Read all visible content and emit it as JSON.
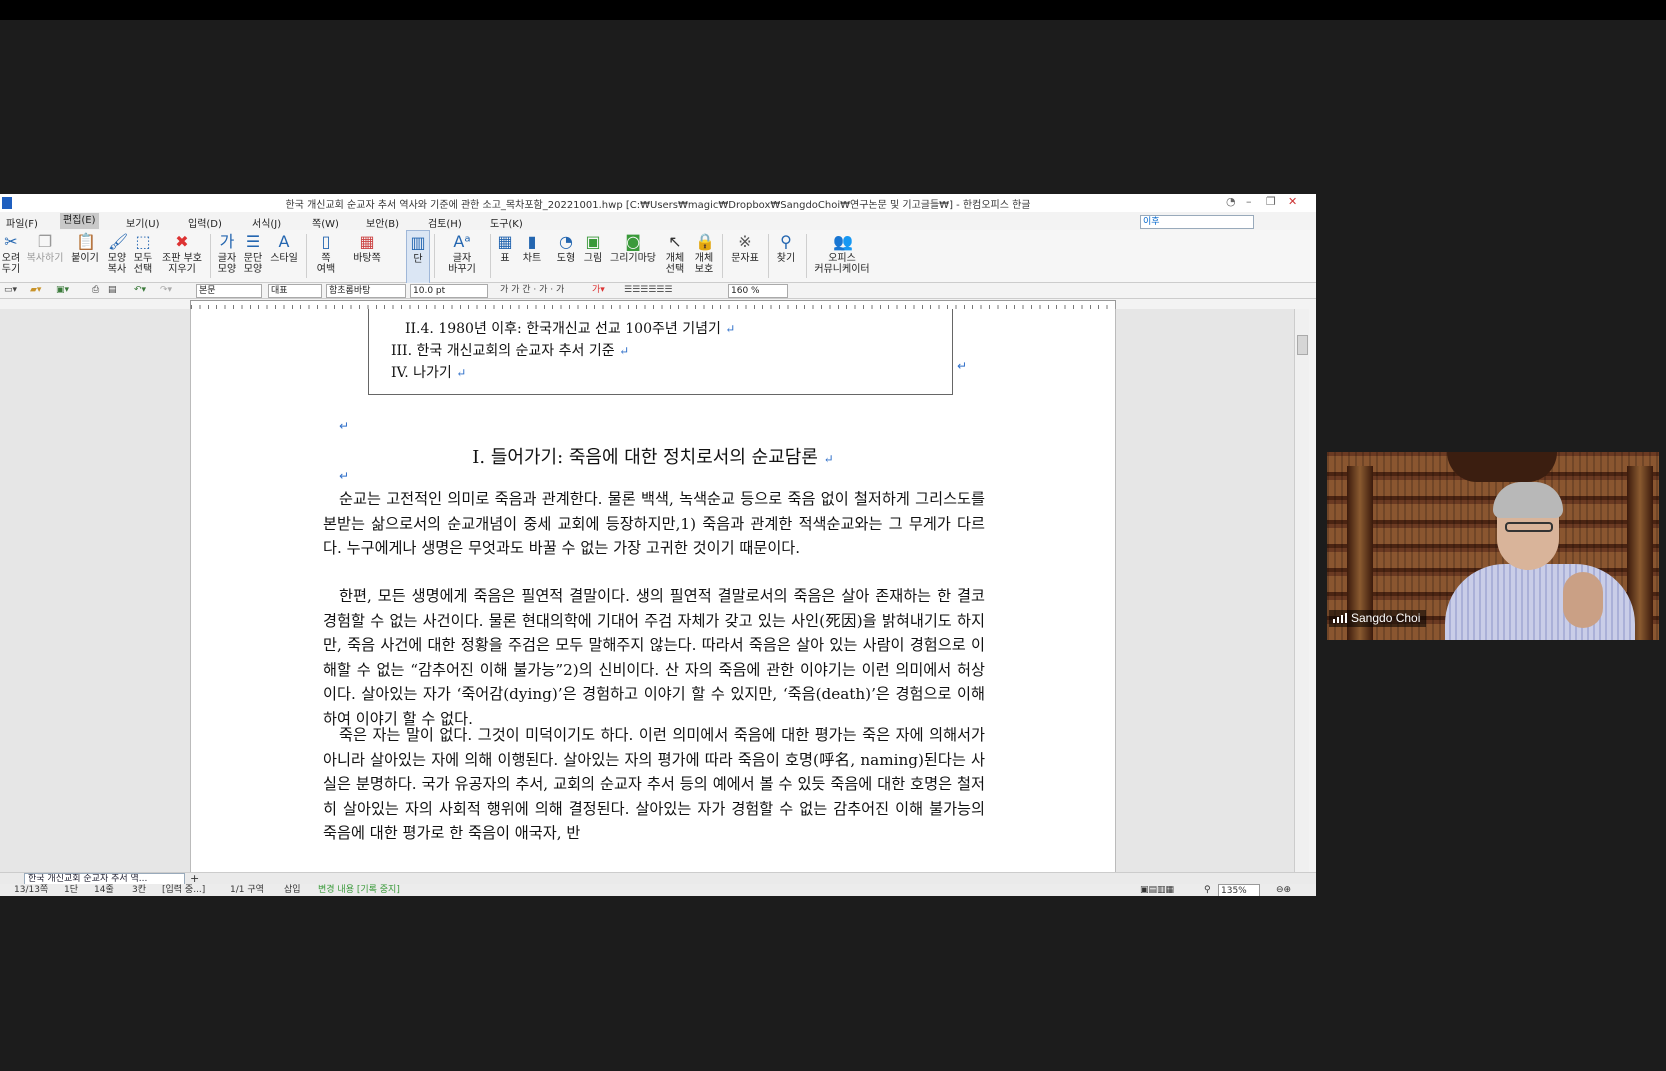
{
  "window": {
    "title": "한국 개신교회 순교자 추서 역사와 기준에 관한 소고_목차포함_20221001.hwp [C:₩Users₩magic₩Dropbox₩SangdoChoi₩연구논문 및 기고글들₩] - 한컴오피스 한글"
  },
  "menu": {
    "items": [
      "파일(F)",
      "편집(E)",
      "보기(U)",
      "입력(D)",
      "서식(J)",
      "쪽(W)",
      "보안(B)",
      "검토(H)",
      "도구(K)"
    ],
    "search_placeholder": "이후"
  },
  "ribbon": {
    "items": [
      {
        "label": "오려\n두기",
        "icon": "scissors-icon"
      },
      {
        "label": "복사하기",
        "icon": "copy-icon"
      },
      {
        "label": "붙이기",
        "icon": "paste-icon"
      },
      {
        "label": "모양\n복사",
        "icon": "format-painter-icon"
      },
      {
        "label": "모두\n선택",
        "icon": "select-all-icon"
      },
      {
        "label": "조판 부호\n지우기",
        "icon": "clear-markup-icon"
      },
      {
        "label": "글자\n모양",
        "icon": "char-shape-icon"
      },
      {
        "label": "문단\n모양",
        "icon": "para-shape-icon"
      },
      {
        "label": "스타일",
        "icon": "style-icon"
      },
      {
        "label": "쪽\n여백",
        "icon": "page-margin-icon"
      },
      {
        "label": "바탕쪽",
        "icon": "master-page-icon"
      },
      {
        "label": "단",
        "icon": "columns-icon"
      },
      {
        "label": "글자\n바꾸기",
        "icon": "replace-char-icon"
      },
      {
        "label": "표",
        "icon": "table-icon"
      },
      {
        "label": "차트",
        "icon": "chart-icon"
      },
      {
        "label": "도형",
        "icon": "shape-icon"
      },
      {
        "label": "그림",
        "icon": "picture-icon"
      },
      {
        "label": "그리기마당",
        "icon": "clipart-icon"
      },
      {
        "label": "개체\n선택",
        "icon": "object-select-icon"
      },
      {
        "label": "개체\n보호",
        "icon": "object-protect-icon"
      },
      {
        "label": "문자표",
        "icon": "symbol-icon"
      },
      {
        "label": "찾기",
        "icon": "find-icon"
      },
      {
        "label": "오피스\n커뮤니케이터",
        "icon": "communicator-icon"
      }
    ]
  },
  "format_bar": {
    "style": "본문",
    "font_lang": "대표",
    "font": "함초롬바탕",
    "size": "10.0 pt",
    "format_glyphs": "가 가 간 · 가 · 가",
    "zoom": "160 %"
  },
  "document": {
    "toc": [
      "II.4. 1980년 이후: 한국개신교 선교 100주년 기념기",
      "III. 한국 개신교회의 순교자 추서 기준",
      "IV. 나가기"
    ],
    "heading": "I. 들어가기: 죽음에 대한 정치로서의 순교담론",
    "paragraphs": [
      "순교는 고전적인 의미로 죽음과 관계한다. 물론 백색, 녹색순교 등으로 죽음 없이 철저하게 그리스도를 본받는 삶으로서의 순교개념이 중세 교회에 등장하지만,1) 죽음과 관계한 적색순교와는 그 무게가 다르다. 누구에게나 생명은 무엇과도 바꿀 수 없는 가장 고귀한 것이기 때문이다.",
      "한편, 모든 생명에게 죽음은 필연적 결말이다. 생의 필연적 결말로서의 죽음은 살아 존재하는 한 결코 경험할 수 없는 사건이다. 물론 현대의학에 기대어 주검 자체가 갖고 있는 사인(死因)을 밝혀내기도 하지만, 죽음 사건에 대한 정황을 주검은 모두 말해주지 않는다. 따라서 죽음은 살아 있는 사람이 경험으로 이해할 수 없는 “감추어진 이해 불가능”2)의 신비이다. 산 자의 죽음에 관한 이야기는 이런 의미에서 허상이다. 살아있는 자가 ‘죽어감(dying)’은 경험하고 이야기 할 수 있지만, ‘죽음(death)’은 경험으로 이해하여 이야기 할 수 없다.",
      "죽은 자는 말이 없다. 그것이 미덕이기도 하다. 이런 의미에서 죽음에 대한 평가는 죽은 자에 의해서가 아니라 살아있는 자에 의해 이행된다. 살아있는 자의 평가에 따라 죽음이 호명(呼名, naming)된다는 사실은 분명하다. 국가 유공자의 추서, 교회의 순교자 추서 등의 예에서 볼 수 있듯 죽음에 대한 호명은 철저히 살아있는 자의 사회적 행위에 의해 결정된다. 살아있는 자가 경험할 수 없는 감추어진 이해 불가능의 죽음에 대한 평가로 한 죽음이 애국자, 반"
    ]
  },
  "tabs": {
    "doc_tab": "한국 개신교회 순교자 추서 역..."
  },
  "status": {
    "page": "13/13쪽",
    "column": "1단",
    "line": "14줄",
    "col": "3칸",
    "input": "[입력 중...]",
    "section": "1/1 구역",
    "mode": "삽입",
    "track": "변경 내용 [기록 중지]",
    "zoom": "135%"
  },
  "video": {
    "participant": "Sangdo Choi"
  }
}
